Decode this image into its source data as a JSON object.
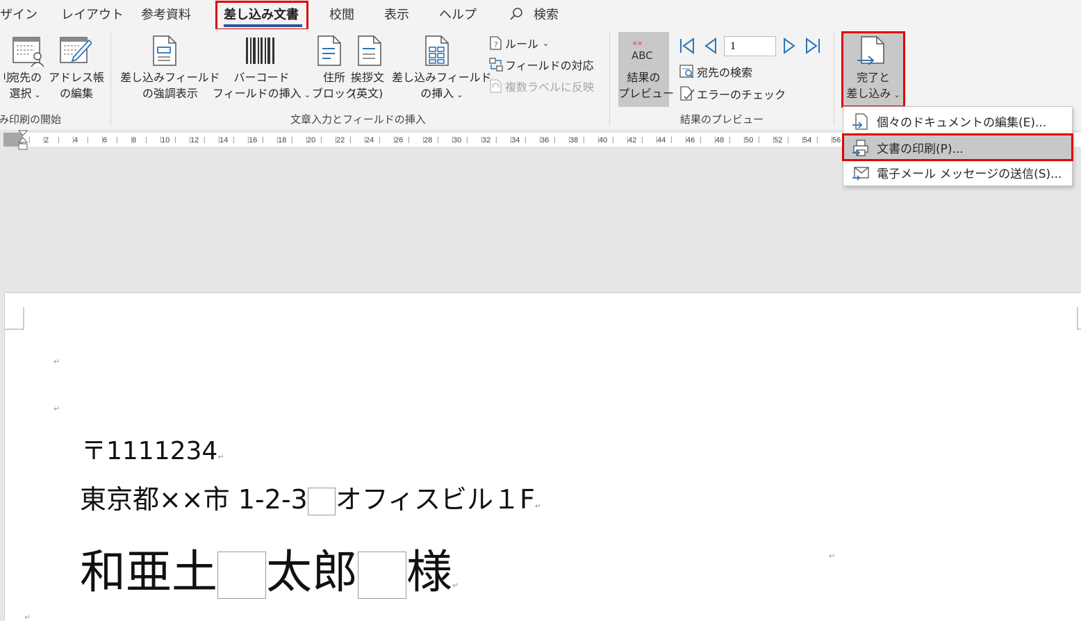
{
  "tabs": [
    {
      "label": "ザイン",
      "active": false
    },
    {
      "label": "レイアウト",
      "active": false
    },
    {
      "label": "参考資料",
      "active": false
    },
    {
      "label": "差し込み文書",
      "active": true
    },
    {
      "label": "校閲",
      "active": false
    },
    {
      "label": "表示",
      "active": false
    },
    {
      "label": "ヘルプ",
      "active": false
    }
  ],
  "search": {
    "label": "検索"
  },
  "ribbon": {
    "groups": {
      "start": "み印刷の開始",
      "insert": "文章入力とフィールドの挿入",
      "preview": "結果のプレビュー"
    },
    "start": {
      "cut_label": "刂",
      "recipients_l1": "宛先の",
      "recipients_l2": "選択",
      "address_l1": "アドレス帳",
      "address_l2": "の編集"
    },
    "insert": {
      "highlight_l1": "差し込みフィールド",
      "highlight_l2": "の強調表示",
      "barcode_l1": "バーコード",
      "barcode_l2": "フィールドの挿入",
      "address_block_l1": "住所",
      "address_block_l2": "ブロック",
      "greeting_l1": "挨拶文",
      "greeting_l2": "(英文)",
      "merge_field_l1": "差し込みフィールド",
      "merge_field_l2": "の挿入",
      "rules": "ルール",
      "match_fields": "フィールドの対応",
      "update_labels": "複数ラベルに反映"
    },
    "preview": {
      "icon_text": "ABC",
      "preview_l1": "結果の",
      "preview_l2": "プレビュー",
      "record_value": "1",
      "find_recipient": "宛先の検索",
      "check_errors": "エラーのチェック"
    },
    "finish": {
      "l1": "完了と",
      "l2": "差し込み"
    }
  },
  "ruler": {
    "ticks": [
      "2",
      "4",
      "6",
      "8",
      "10",
      "12",
      "14",
      "16",
      "18",
      "20",
      "22",
      "24",
      "26",
      "28",
      "30",
      "32",
      "34",
      "36",
      "38",
      "40",
      "42",
      "44",
      "46",
      "48",
      "50",
      "52",
      "54",
      "56"
    ]
  },
  "dropdown": {
    "items": [
      {
        "label": "個々のドキュメントの編集(E)..."
      },
      {
        "label": "文書の印刷(P)..."
      },
      {
        "label": "電子メール メッセージの送信(S)..."
      }
    ],
    "highlighted_index": 1
  },
  "document": {
    "postal": "〒1111234",
    "address_part1": "東京都××市 1-2-3",
    "address_part2": "オフィスビル１F",
    "name_part1": "和亜土",
    "name_part2": "太郎",
    "name_part3": "様",
    "para_mark": "↵"
  },
  "colors": {
    "accent": "#2b579a",
    "highlight_box": "#e00000",
    "icon_blue": "#2e75b6"
  }
}
